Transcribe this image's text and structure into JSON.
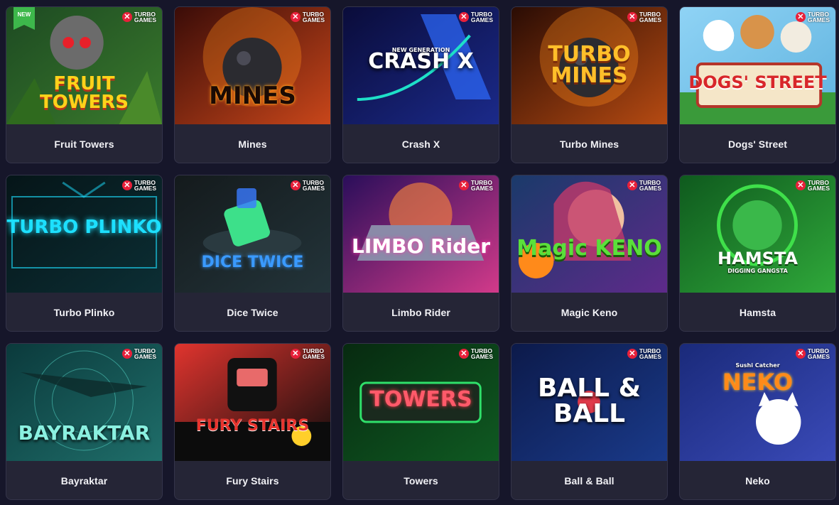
{
  "brand": {
    "logo_glyph": "✕",
    "line1": "TURBO",
    "line2": "GAMES"
  },
  "badge_new": "NEW",
  "games": [
    {
      "title": "Fruit Towers",
      "art": "FRUIT TOWERS",
      "theme": "jungle",
      "colors": [
        "#1d4a22",
        "#3a7a2c"
      ]
    },
    {
      "title": "Mines",
      "art": "MINES",
      "theme": "fire",
      "colors": [
        "#3a0c08",
        "#c8461a"
      ]
    },
    {
      "title": "Crash X",
      "art": "CRASH X",
      "sub": "NEW GENERATION",
      "theme": "space",
      "colors": [
        "#0a0c3a",
        "#1b2a8a"
      ]
    },
    {
      "title": "Turbo Mines",
      "art": "TURBO MINES",
      "theme": "fire2",
      "colors": [
        "#2a0c04",
        "#b54a12"
      ]
    },
    {
      "title": "Dogs' Street",
      "art": "DOGS' STREET",
      "theme": "dogs",
      "colors": [
        "#8fd3f5",
        "#5fb2de"
      ]
    },
    {
      "title": "Turbo Plinko",
      "art": "TURBO PLINKO",
      "theme": "neon",
      "colors": [
        "#051518",
        "#0c2e34"
      ]
    },
    {
      "title": "Dice Twice",
      "art": "DICE TWICE",
      "theme": "dice",
      "colors": [
        "#141a1c",
        "#23343a"
      ]
    },
    {
      "title": "Limbo Rider",
      "art": "LIMBO Rider",
      "theme": "synth",
      "colors": [
        "#2a0e5a",
        "#d23a8a"
      ]
    },
    {
      "title": "Magic Keno",
      "art": "Magic KENO",
      "theme": "magic",
      "colors": [
        "#1a3a6a",
        "#5e2a8a"
      ]
    },
    {
      "title": "Hamsta",
      "art": "HAMSTA",
      "sub": "DIGGING GANGSTA",
      "theme": "green",
      "colors": [
        "#0f5a1e",
        "#2fa83a"
      ]
    },
    {
      "title": "Bayraktar",
      "art": "BAYRAKTAR",
      "theme": "radar",
      "colors": [
        "#0b3a3c",
        "#1f6e6a"
      ]
    },
    {
      "title": "Fury Stairs",
      "art": "FURY STAIRS",
      "theme": "red",
      "colors": [
        "#e0342e",
        "#0c0c0c"
      ]
    },
    {
      "title": "Towers",
      "art": "TOWERS",
      "theme": "greenneon",
      "colors": [
        "#072a10",
        "#0f5a22"
      ]
    },
    {
      "title": "Ball & Ball",
      "art": "BALL & BALL",
      "theme": "blue",
      "colors": [
        "#0c1a4a",
        "#1a3a8a"
      ]
    },
    {
      "title": "Neko",
      "art": "NEKO",
      "sub": "Sushi Catcher",
      "theme": "neko",
      "colors": [
        "#1a2a7a",
        "#3a4ab8"
      ]
    }
  ]
}
